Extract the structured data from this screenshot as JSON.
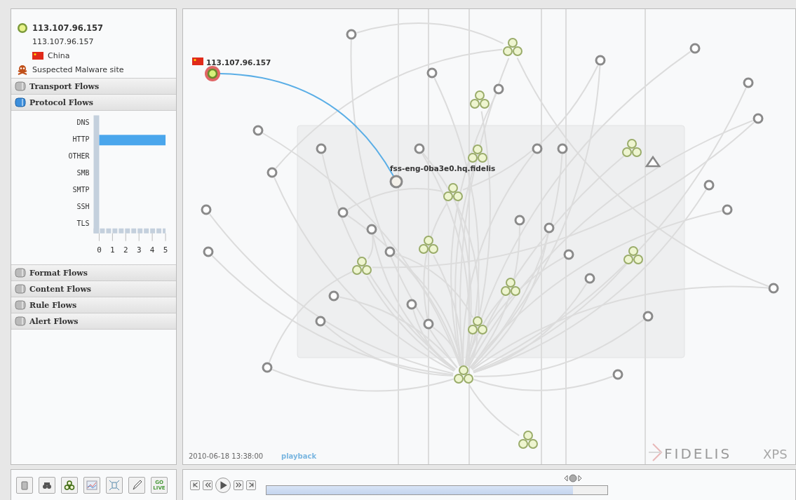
{
  "selection": {
    "title": "113.107.96.157",
    "address": "113.107.96.157",
    "country": "China",
    "threat": "Suspected Malware site"
  },
  "sections": [
    {
      "label": "Transport Flows",
      "expanded": false
    },
    {
      "label": "Protocol Flows",
      "expanded": true,
      "chart_data": {
        "type": "bar",
        "orientation": "horizontal",
        "categories": [
          "DNS",
          "HTTP",
          "OTHER",
          "SMB",
          "SMTP",
          "SSH",
          "TLS"
        ],
        "values": [
          0,
          5,
          0,
          0,
          0,
          0,
          0
        ],
        "xlim": [
          0,
          5
        ],
        "xticks": [
          0,
          1,
          2,
          3,
          4,
          5
        ]
      }
    },
    {
      "label": "Format Flows",
      "expanded": false
    },
    {
      "label": "Content Flows",
      "expanded": false
    },
    {
      "label": "Rule Flows",
      "expanded": false
    },
    {
      "label": "Alert Flows",
      "expanded": false
    }
  ],
  "graph": {
    "source_label": "113.107.96.157",
    "target_label": "fss-eng-0ba3e0.hq.fidelis",
    "timestamp": "2010-06-18 13:38:00",
    "mode": "playback",
    "logo": "FIDELIS",
    "logo_suffix": "XPS"
  },
  "toolbar": [
    {
      "kind": "trash"
    },
    {
      "kind": "binoculars"
    },
    {
      "kind": "group"
    },
    {
      "kind": "chart"
    },
    {
      "kind": "fit"
    },
    {
      "kind": "pencil"
    },
    {
      "kind": "live",
      "label": "GO LIVE"
    }
  ],
  "player": [
    {
      "kind": "first"
    },
    {
      "kind": "rewind"
    },
    {
      "kind": "play"
    },
    {
      "kind": "forward"
    },
    {
      "kind": "last"
    }
  ],
  "timeline": {
    "level": 0.9
  }
}
